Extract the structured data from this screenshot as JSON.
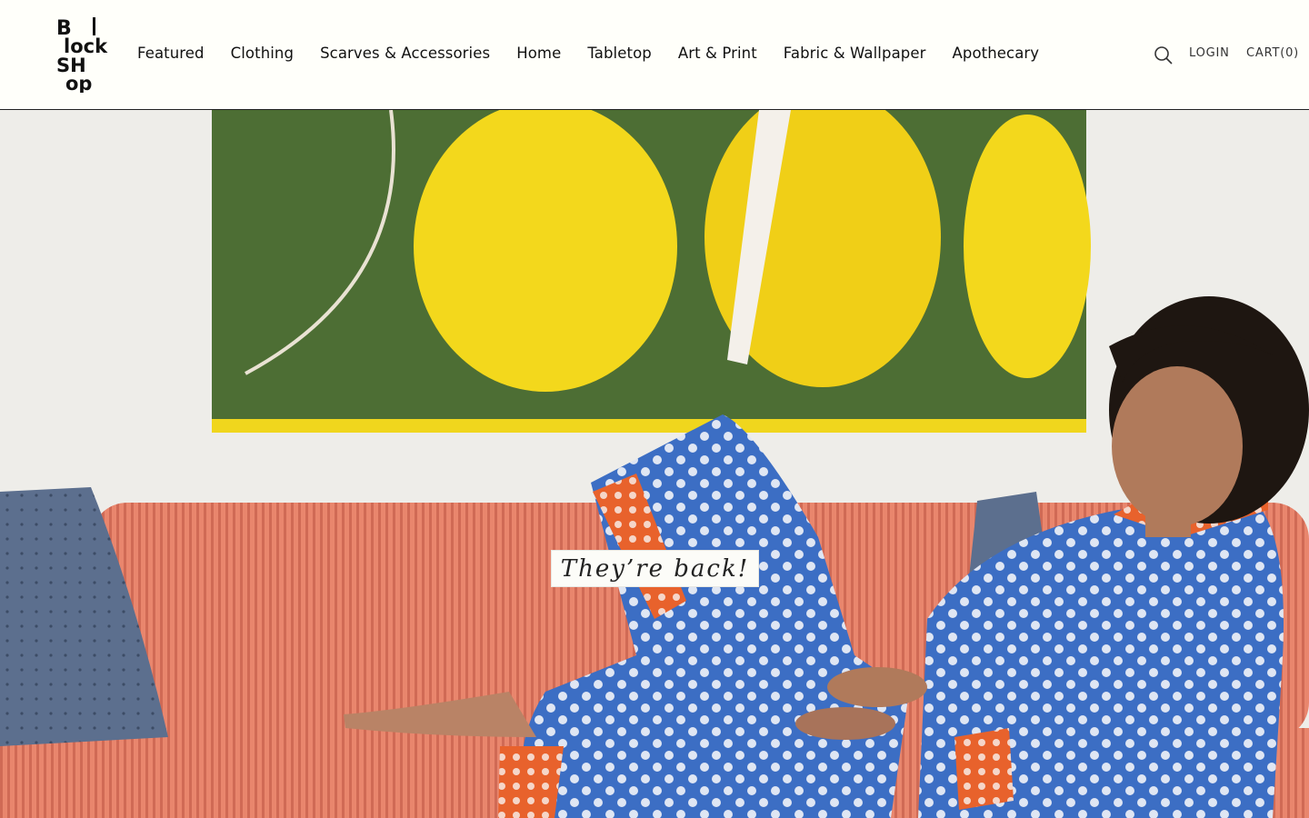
{
  "brand": {
    "logo_text": "BlockShop"
  },
  "nav": {
    "items": [
      {
        "label": "Featured"
      },
      {
        "label": "Clothing"
      },
      {
        "label": "Scarves & Accessories"
      },
      {
        "label": "Home"
      },
      {
        "label": "Tabletop"
      },
      {
        "label": "Art & Print"
      },
      {
        "label": "Fabric & Wallpaper"
      },
      {
        "label": "Apothecary"
      }
    ]
  },
  "utility": {
    "search_icon": "search-icon",
    "login_label": "LOGIN",
    "cart_label": "CART(0)"
  },
  "hero": {
    "caption": "They’re back!"
  },
  "colors": {
    "background": "#fffffa",
    "text": "#111111",
    "painting_green": "#4d6e34",
    "painting_yellow": "#f3d81c",
    "sofa_coral": "#e9866d",
    "pajama_blue": "#3c6ec4",
    "pajama_orange": "#e8622c"
  }
}
